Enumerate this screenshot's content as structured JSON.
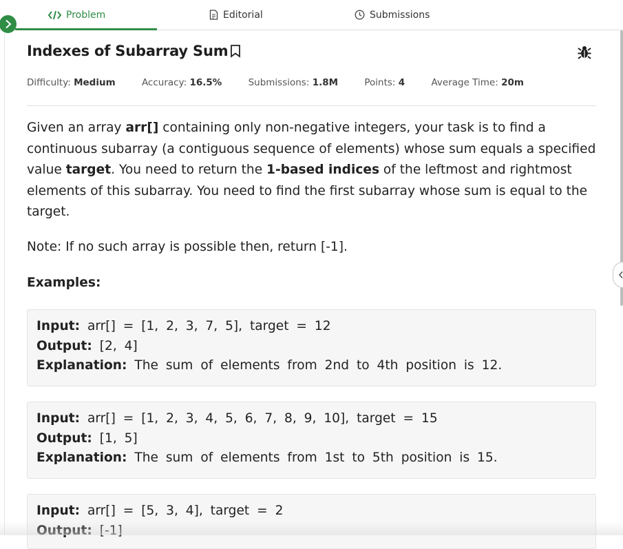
{
  "tabs": [
    {
      "label": "Problem",
      "icon": "code-icon",
      "active": true
    },
    {
      "label": "Editorial",
      "icon": "document-icon"
    },
    {
      "label": "Submissions",
      "icon": "clock-icon"
    }
  ],
  "problem": {
    "title": "Indexes of Subarray Sum",
    "meta": [
      {
        "label": "Difficulty:",
        "value": "Medium"
      },
      {
        "label": "Accuracy:",
        "value": "16.5%"
      },
      {
        "label": "Submissions:",
        "value": "1.8M"
      },
      {
        "label": "Points:",
        "value": "4"
      },
      {
        "label": "Average Time:",
        "value": "20m"
      }
    ],
    "description": {
      "p1": "Given an array ",
      "b1": "arr[]",
      "p2": " containing only non-negative integers, your task is to find a continuous subarray (a contiguous sequence of elements) whose sum equals a specified value ",
      "b2": "target",
      "p3": ". You need to return the ",
      "b3": "1-based indices",
      "p4": " of the leftmost and rightmost elements of this subarray. You need to find the first subarray whose sum is equal to the target."
    },
    "note": "Note: If no such array is possible then, return [-1].",
    "examples_heading": "Examples:",
    "labels": {
      "input": "Input:",
      "output": "Output:",
      "explanation": "Explanation:"
    },
    "examples": [
      {
        "input": "arr[] = [1, 2, 3, 7, 5], target = 12",
        "output": "[2, 4]",
        "explanation": "The sum of elements from 2nd to 4th position is 12."
      },
      {
        "input": "arr[] = [1, 2, 3, 4, 5, 6, 7, 8, 9, 10], target = 15",
        "output": "[1, 5]",
        "explanation": "The sum of elements from 1st to 5th position is 15."
      },
      {
        "input": "arr[] = [5, 3, 4], target = 2",
        "output": "[-1]"
      }
    ]
  },
  "colors": {
    "accent": "#2f8d46",
    "example_bg": "#f6f6f6"
  }
}
